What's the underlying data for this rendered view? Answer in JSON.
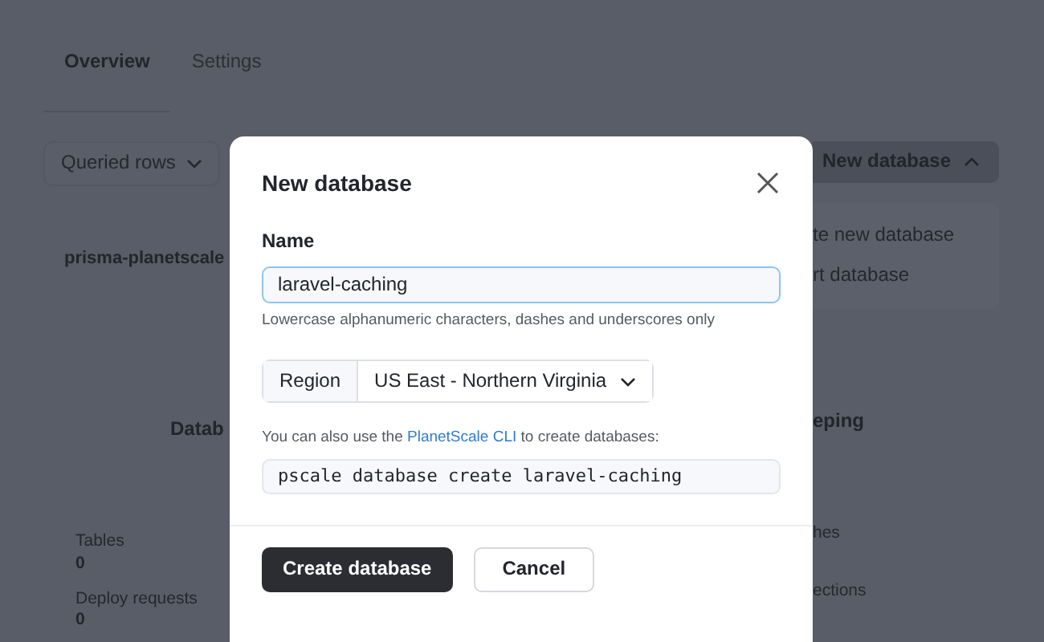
{
  "tabs": [
    {
      "label": "Overview",
      "selected": true
    },
    {
      "label": "Settings",
      "selected": false
    }
  ],
  "toolbar": {
    "filter": "Queried rows",
    "new_button": "New database"
  },
  "new_menu": [
    "te new database",
    "rt database"
  ],
  "database_name": "prisma-planetscale",
  "panel_titles": [
    "Datab",
    "eping"
  ],
  "stats_left": [
    {
      "label": "Tables",
      "value": "0"
    },
    {
      "label": "Deploy requests",
      "value": "0"
    }
  ],
  "stats_right": [
    "hes",
    "ections"
  ],
  "modal": {
    "title": "New database",
    "name_label": "Name",
    "name_value": "laravel-caching",
    "name_help": "Lowercase alphanumeric characters, dashes and underscores only",
    "region_label": "Region",
    "region_value": "US East - Northern Virginia",
    "cli_before": "You can also use the ",
    "cli_link": "PlanetScale CLI",
    "cli_after": " to create databases:",
    "command": "pscale database create laravel-caching",
    "buttons": [
      {
        "label": "Create database",
        "kind": "primary"
      },
      {
        "label": "Cancel",
        "kind": "secondary"
      }
    ]
  }
}
